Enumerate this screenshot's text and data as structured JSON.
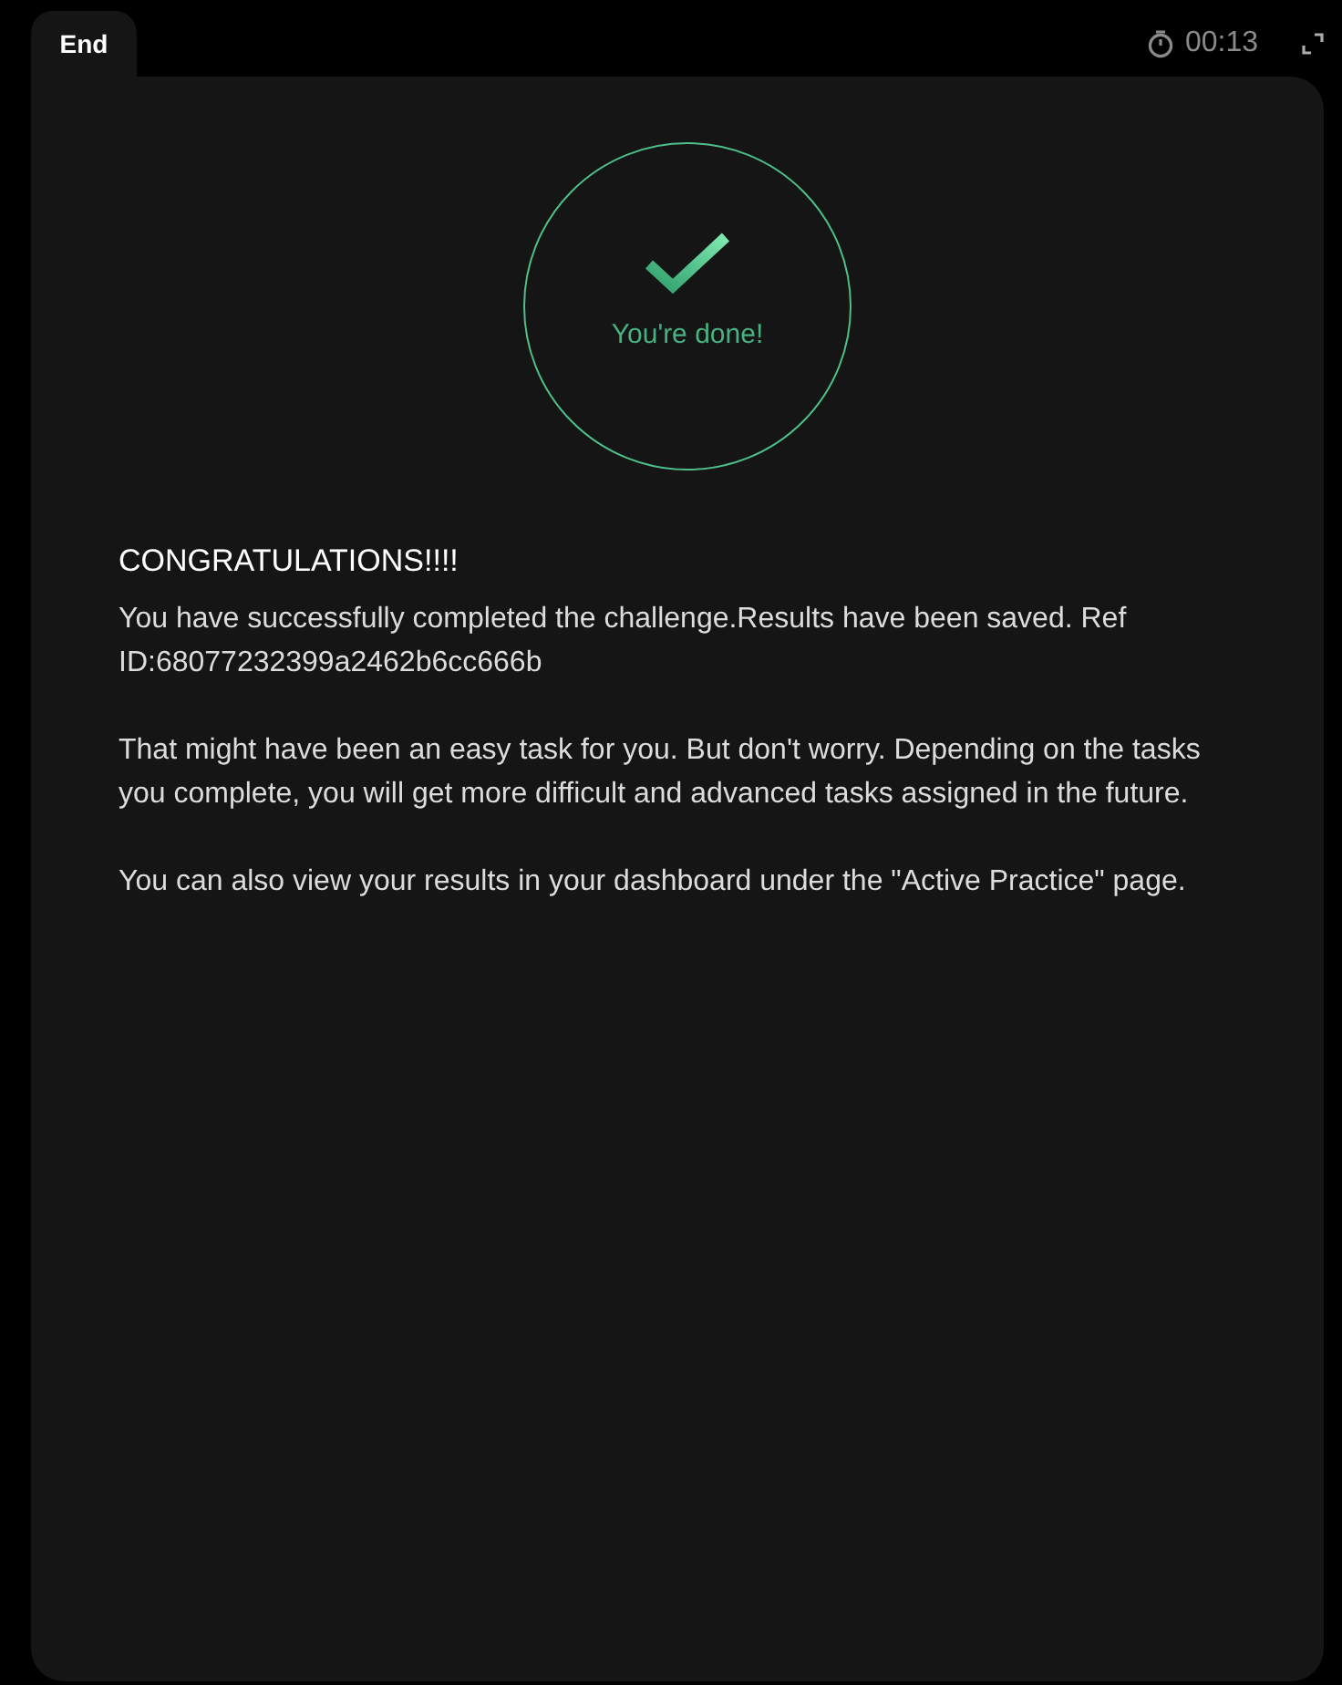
{
  "tab": {
    "label": "End"
  },
  "timer": "00:13",
  "status": {
    "label": "You're done!"
  },
  "heading": "CONGRATULATIONS!!!!",
  "paragraphs": [
    "You have successfully completed the challenge.Results have been saved. Ref ID:68077232399a2462b6cc666b",
    "That might have been an easy task for you. But don't worry. Depending on the tasks you complete, you will get more difficult and advanced tasks assigned in the future.",
    "You can also view your results in your dashboard under the \"Active Practice\" page."
  ]
}
